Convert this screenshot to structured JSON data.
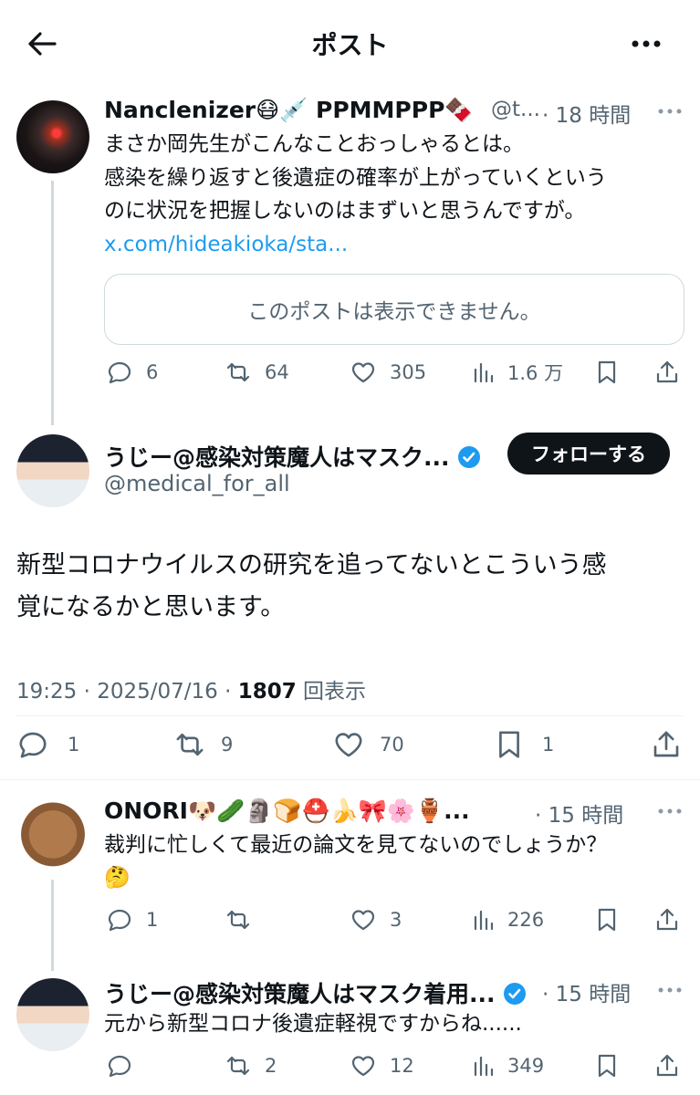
{
  "header": {
    "title": "ポスト"
  },
  "icons": {
    "back": "arrow-left-icon",
    "more": "more-icon",
    "reply": "reply-icon",
    "repost": "repost-icon",
    "like": "heart-icon",
    "views": "views-icon",
    "bookmark": "bookmark-icon",
    "share": "share-icon"
  },
  "colors": {
    "accent": "#1d9bf0",
    "text": "#0f1419",
    "muted": "#536471",
    "border": "#cfd9de"
  },
  "parent": {
    "name": "Nanclenizer😷💉 PPMMPPP🍫",
    "handle": "@t...",
    "time": "· 18 時間",
    "text1": "まさか岡先生がこんなことおっしゃるとは。",
    "text2": "感染を繰り返すと後遺症の確率が上がっていくという",
    "text3": "のに状況を把握しないのはまずいと思うんですが。",
    "link": "x.com/hideakioka/sta...",
    "quote": "このポストは表示できません。",
    "replies": "6",
    "reposts": "64",
    "likes": "305",
    "views": "1.6 万"
  },
  "main": {
    "name": "うじー@感染対策魔人はマスク...",
    "handle": "@medical_for_all",
    "follow": "フォローする",
    "text1": "新型コロナウイルスの研究を追ってないとこういう感",
    "text2": "覚になるかと思います。",
    "time": "19:25 · 2025/07/16 · ",
    "views_count": "1807",
    "views_label": " 回表示",
    "replies": "1",
    "reposts": "9",
    "likes": "70",
    "bookmarks": "1"
  },
  "reply1": {
    "name": "ONORI🐶🥒🗿🍞⛑️🍌🎀🌸🏺...",
    "time": "· 15 時間",
    "text1": "裁判に忙しくて最近の論文を見てないのでしょうか？",
    "text2": "🤔",
    "replies": "1",
    "reposts": "",
    "likes": "3",
    "views": "226"
  },
  "reply2": {
    "name": "うじー@感染対策魔人はマスク着用...",
    "time": "· 15 時間",
    "text1": "元から新型コロナ後遺症軽視ですからね......",
    "replies": "",
    "reposts": "2",
    "likes": "12",
    "views": "349"
  }
}
